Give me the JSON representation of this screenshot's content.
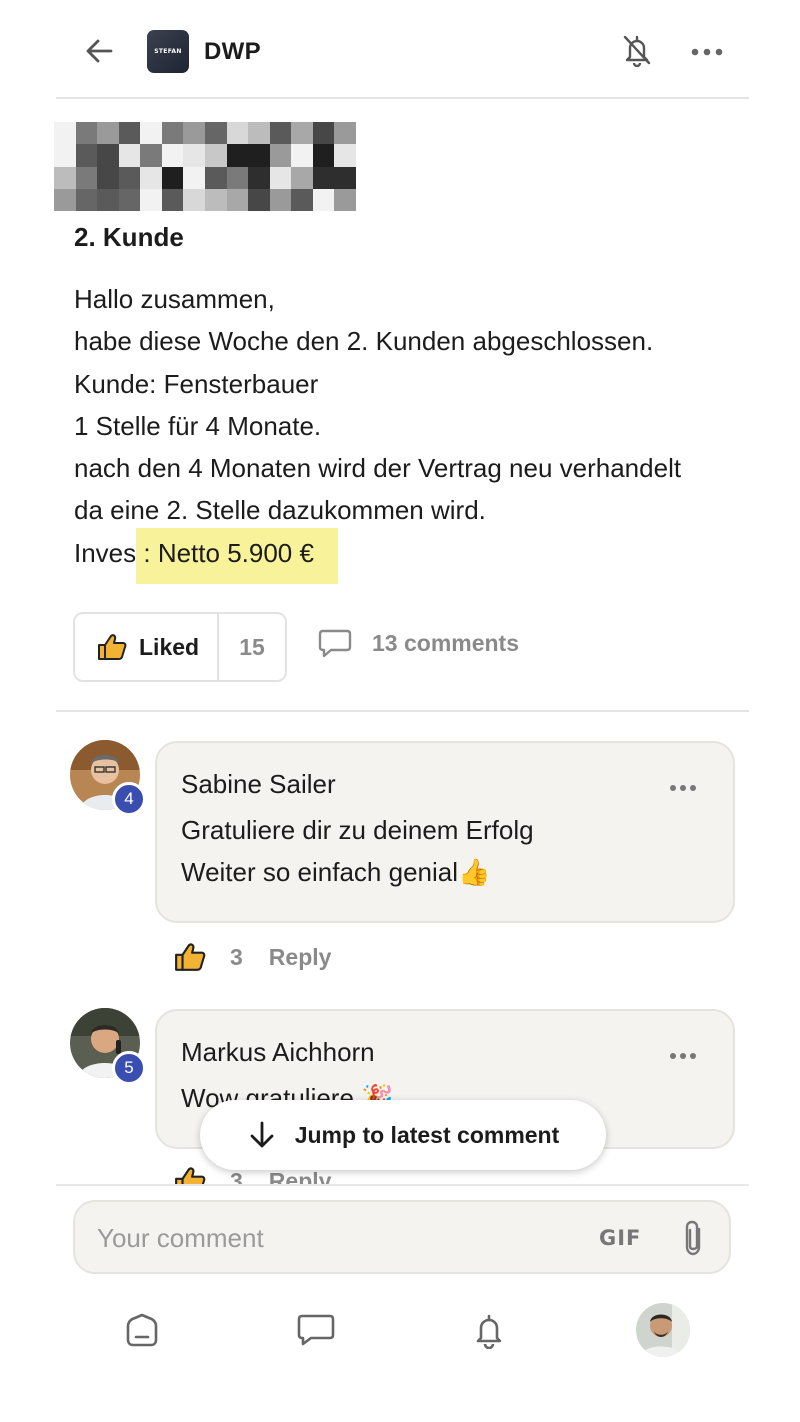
{
  "header": {
    "title": "DWP",
    "logo_text": "STEFAN",
    "icons": {
      "back": "arrow-left-icon",
      "mute": "bell-off-icon",
      "more": "more-horizontal-icon"
    }
  },
  "post": {
    "title": "2. Kunde",
    "lines": [
      "Hallo zusammen,",
      "habe diese Woche den 2. Kunden abgeschlossen.",
      "Kunde: Fensterbauer",
      "1 Stelle für 4 Monate.",
      "nach den 4 Monaten wird der Vertrag neu verhandelt",
      "da eine 2. Stelle dazukommen wird."
    ],
    "invest_prefix": "Invest",
    "invest_highlight": ": Netto 5.900 €",
    "like_label": "Liked",
    "like_count": "15",
    "comments_label": "13 comments"
  },
  "comments": [
    {
      "author": "Sabine Sailer",
      "badge": "4",
      "lines": [
        "Gratuliere dir zu deinem Erfolg",
        "Weiter so einfach genial👍"
      ],
      "likes": "3",
      "reply_label": "Reply"
    },
    {
      "author": "Markus Aichhorn",
      "badge": "5",
      "lines": [
        "Wow gratuliere 🎉"
      ],
      "likes": "3",
      "reply_label": "Reply"
    }
  ],
  "jump_label": "Jump to latest comment",
  "composer": {
    "placeholder": "Your comment",
    "gif_label": "GIF"
  },
  "nav": {
    "items": [
      "home-icon",
      "chat-icon",
      "notifications-icon",
      "profile-avatar"
    ]
  },
  "colors": {
    "highlight": "#f8f39a",
    "badge": "#3a4db0",
    "bubble": "#f5f3f0",
    "muted_text": "#8a8a8a"
  }
}
